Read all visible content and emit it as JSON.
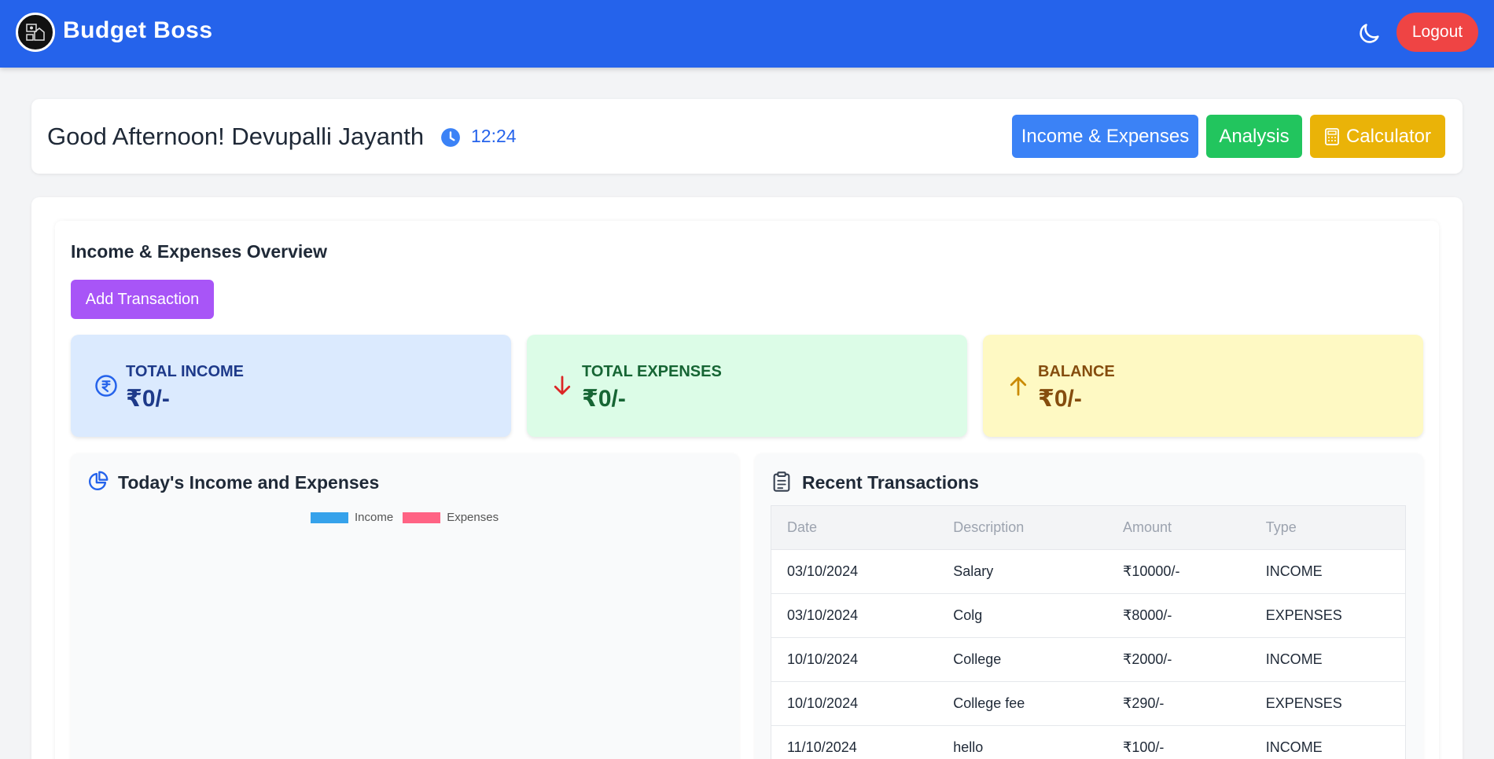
{
  "header": {
    "app_title": "Budget Boss",
    "logout_label": "Logout",
    "logo_icon": "budget-logo-icon",
    "theme_icon": "moon-icon"
  },
  "greeting": {
    "text": "Good Afternoon! Devupalli Jayanth",
    "time": "12:24",
    "nav": {
      "income_expenses": "Income & Expenses",
      "analysis": "Analysis",
      "calculator": "Calculator"
    }
  },
  "overview": {
    "title": "Income & Expenses Overview",
    "add_transaction": "Add Transaction",
    "stats": {
      "income": {
        "label": "TOTAL INCOME",
        "value": "₹0/-"
      },
      "expenses": {
        "label": "TOTAL EXPENSES",
        "value": "₹0/-"
      },
      "balance": {
        "label": "BALANCE",
        "value": "₹0/-"
      }
    }
  },
  "chart_panel": {
    "title": "Today's Income and Expenses",
    "legend": {
      "income": "Income",
      "expenses": "Expenses"
    }
  },
  "chart_data": {
    "type": "pie",
    "series": [
      {
        "name": "Income",
        "color": "#36a2eb"
      },
      {
        "name": "Expenses",
        "color": "#ff6384"
      }
    ]
  },
  "transactions": {
    "title": "Recent Transactions",
    "columns": [
      "Date",
      "Description",
      "Amount",
      "Type"
    ],
    "rows": [
      [
        "03/10/2024",
        "Salary",
        "₹10000/-",
        "INCOME"
      ],
      [
        "03/10/2024",
        "Colg",
        "₹8000/-",
        "EXPENSES"
      ],
      [
        "10/10/2024",
        "College",
        "₹2000/-",
        "INCOME"
      ],
      [
        "10/10/2024",
        "College fee",
        "₹290/-",
        "EXPENSES"
      ],
      [
        "11/10/2024",
        "hello",
        "₹100/-",
        "INCOME"
      ]
    ]
  },
  "colors": {
    "topbar": "#2563eb",
    "logout": "#ef4444",
    "income_expenses_btn": "#3b82f6",
    "analysis_btn": "#22c55e",
    "calculator_btn": "#eab308",
    "add_transaction_btn": "#a855f7"
  }
}
